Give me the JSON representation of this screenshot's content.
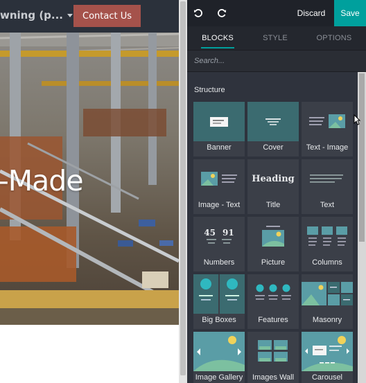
{
  "preview": {
    "nav_menu_text": "wning (p...",
    "contact_button": "Contact Us",
    "hero_title": "-Made"
  },
  "editor": {
    "undo_icon": "undo-icon",
    "redo_icon": "redo-icon",
    "discard": "Discard",
    "save": "Save",
    "tabs": [
      {
        "label": "BLOCKS",
        "active": true
      },
      {
        "label": "STYLE",
        "active": false
      },
      {
        "label": "OPTIONS",
        "active": false
      }
    ],
    "search_placeholder": "Search...",
    "section_title": "Structure",
    "blocks": [
      {
        "label": "Banner",
        "icon": "banner-icon"
      },
      {
        "label": "Cover",
        "icon": "cover-icon"
      },
      {
        "label": "Text - Image",
        "icon": "text-image-icon"
      },
      {
        "label": "Image - Text",
        "icon": "image-text-icon"
      },
      {
        "label": "Title",
        "icon": "title-icon",
        "thumb_text": "Heading"
      },
      {
        "label": "Text",
        "icon": "text-icon"
      },
      {
        "label": "Numbers",
        "icon": "numbers-icon",
        "thumb_numbers": [
          "45",
          "91"
        ]
      },
      {
        "label": "Picture",
        "icon": "picture-icon"
      },
      {
        "label": "Columns",
        "icon": "columns-icon"
      },
      {
        "label": "Big Boxes",
        "icon": "big-boxes-icon"
      },
      {
        "label": "Features",
        "icon": "features-icon"
      },
      {
        "label": "Masonry",
        "icon": "masonry-icon"
      },
      {
        "label": "Image Gallery",
        "icon": "image-gallery-icon"
      },
      {
        "label": "Images Wall",
        "icon": "images-wall-icon"
      },
      {
        "label": "Carousel",
        "icon": "carousel-icon"
      }
    ]
  },
  "colors": {
    "accent": "#00a09d",
    "contact_button": "#a5524b",
    "panel_bg": "#2f333d",
    "block_bg": "#3b3f48",
    "teal_thumb": "#3b6b70"
  }
}
